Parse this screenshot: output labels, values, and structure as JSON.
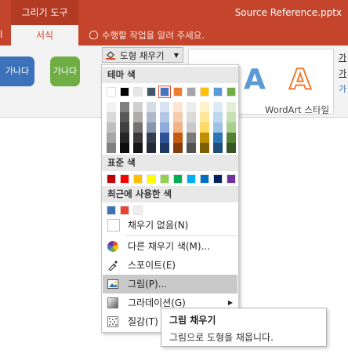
{
  "title_bar": {
    "context_tab": "그리기 도구",
    "document_title": "Source Reference.pptx"
  },
  "tabs": {
    "left_partial": "l",
    "format": "서식",
    "tell_me": "수행할 작업을 알려 주세요."
  },
  "ribbon": {
    "shape_style_1": "가나다",
    "shape_style_2": "가나다",
    "fill_button": "도형 채우기",
    "wordart_a1": "A",
    "wordart_a2": "A",
    "wordart_right_1": "가",
    "wordart_right_2": "가",
    "wordart_right_3": "가",
    "wordart_group_label": "WordArt 스타일"
  },
  "menu": {
    "theme_colors_header": "테마 색",
    "standard_colors_header": "표준 색",
    "recent_colors_header": "최근에 사용한 색",
    "no_fill": "채우기 없음(N)",
    "more_colors": "다른 채우기 색(M)...",
    "eyedropper": "스포이트(E)",
    "picture": "그림(P)...",
    "gradient": "그라데이션(G)",
    "texture": "질감(T)",
    "theme_top_row": [
      "#ffffff",
      "#000000",
      "#e7e6e6",
      "#44546a",
      "#4472c4",
      "#ed7d31",
      "#a5a5a5",
      "#ffc000",
      "#5b9bd5",
      "#70ad47"
    ],
    "theme_shades": [
      [
        "#f2f2f2",
        "#d9d9d9",
        "#bfbfbf",
        "#a6a6a6",
        "#808080"
      ],
      [
        "#808080",
        "#595959",
        "#404040",
        "#262626",
        "#0d0d0d"
      ],
      [
        "#d0cece",
        "#aeabab",
        "#757171",
        "#3a3838",
        "#171616"
      ],
      [
        "#d6dce4",
        "#adb9ca",
        "#8497b0",
        "#333f4f",
        "#222a35"
      ],
      [
        "#d9e2f3",
        "#b4c6e7",
        "#8eaadb",
        "#2f5496",
        "#1f3864"
      ],
      [
        "#fbe5d5",
        "#f7cbac",
        "#f4b183",
        "#c55a11",
        "#843c0b"
      ],
      [
        "#ededed",
        "#dbdbdb",
        "#c9c9c9",
        "#7b7b7b",
        "#525252"
      ],
      [
        "#fff2cc",
        "#ffe599",
        "#ffd966",
        "#bf9000",
        "#7f6000"
      ],
      [
        "#deebf6",
        "#bdd7ee",
        "#9cc3e5",
        "#2e75b5",
        "#1e4e79"
      ],
      [
        "#e2efd9",
        "#c5e0b3",
        "#a8d08d",
        "#538135",
        "#375623"
      ]
    ],
    "standard_colors": [
      "#c00000",
      "#ff0000",
      "#ffc000",
      "#ffff00",
      "#92d050",
      "#00b050",
      "#00b0f0",
      "#0070c0",
      "#002060",
      "#7030a0"
    ],
    "recent_colors": [
      "#3a72b5",
      "#ea4335",
      "#eeeeee"
    ]
  },
  "tooltip": {
    "title": "그림 채우기",
    "description": "그림으로 도형을 채웁니다."
  }
}
